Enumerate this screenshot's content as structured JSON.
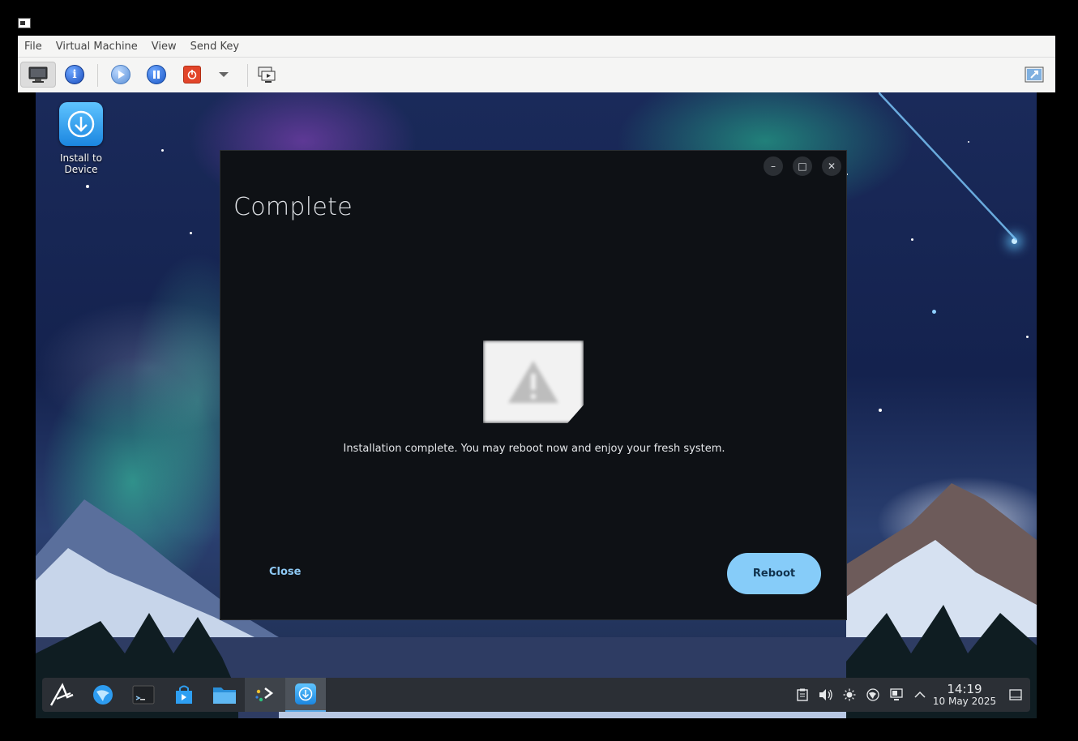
{
  "menubar": {
    "items": [
      "File",
      "Virtual Machine",
      "View",
      "Send Key"
    ]
  },
  "toolbar": {
    "info_glyph": "i",
    "buttons": [
      "monitor-icon",
      "info-icon",
      "run-icon",
      "pause-icon",
      "shutdown-icon",
      "dropdown-arrow-icon",
      "snapshots-icon",
      "fullscreen-icon"
    ]
  },
  "desktop": {
    "install_icon_label": "Install to Device"
  },
  "dialog": {
    "title": "Complete",
    "message": "Installation complete. You may reboot now and enjoy your fresh system.",
    "close_label": "Close",
    "reboot_label": "Reboot",
    "controls": {
      "minimize": "–",
      "maximize": "□",
      "close": "✕"
    }
  },
  "taskbar": {
    "apps": [
      "app-launcher-icon",
      "browser-icon",
      "terminal-icon",
      "software-store-icon",
      "file-manager-icon",
      "kde-connect-icon",
      "installer-icon"
    ],
    "tray": [
      "clipboard-icon",
      "volume-icon",
      "brightness-icon",
      "network-icon",
      "display-icon",
      "tray-expand-icon"
    ],
    "time": "14:19",
    "date": "10 May 2025"
  },
  "colors": {
    "accent": "#86ccf9",
    "dialog_bg": "#0e1115",
    "taskbar_bg": "#2b2f35"
  }
}
